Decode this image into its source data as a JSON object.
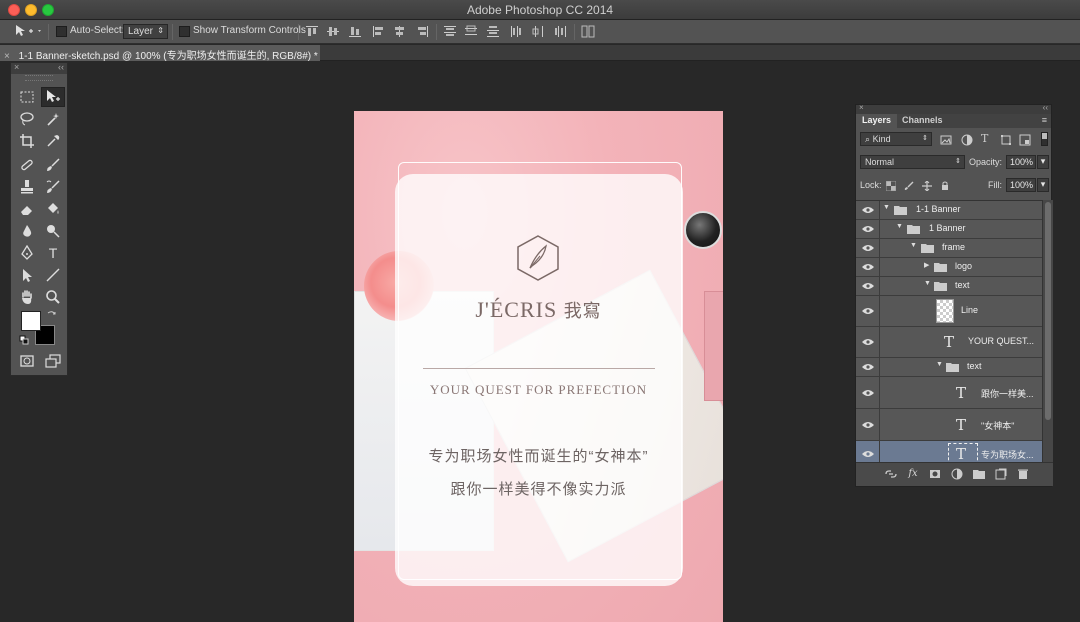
{
  "app": {
    "title": "Adobe Photoshop CC 2014"
  },
  "options_bar": {
    "auto_select_label": "Auto-Select:",
    "auto_select_value": "Layer",
    "show_transform_label": "Show Transform Controls"
  },
  "document": {
    "tab_title": "1-1 Banner-sketch.psd @ 100% (专为职场女性而诞生的, RGB/8#) *"
  },
  "toolbox": {
    "tools": [
      "rectangular-marquee",
      "move",
      "lasso",
      "magic-wand",
      "crop",
      "eyedropper",
      "spot-healing",
      "brush",
      "clone-stamp",
      "history-brush",
      "eraser",
      "paint-bucket",
      "blur",
      "dodge",
      "pen",
      "type",
      "path-selection",
      "line",
      "hand",
      "zoom"
    ],
    "foreground_color": "#ffffff",
    "background_color": "#000000"
  },
  "canvas": {
    "brand_latin": "J'ÉCRIS",
    "brand_cn": "我寫",
    "tagline": "YOUR QUEST FOR PREFECTION",
    "line1": "专为职场女性而诞生的“女神本”",
    "line2": "跟你一样美得不像实力派"
  },
  "layers_panel": {
    "tabs": [
      "Layers",
      "Channels"
    ],
    "filter_kind": "Kind",
    "blend_mode": "Normal",
    "opacity_label": "Opacity:",
    "opacity_value": "100%",
    "lock_label": "Lock:",
    "fill_label": "Fill:",
    "fill_value": "100%",
    "rows": [
      {
        "name": "1-1 Banner",
        "type": "group",
        "indent": 0,
        "expanded": true
      },
      {
        "name": "1 Banner",
        "type": "group",
        "indent": 1,
        "expanded": true
      },
      {
        "name": "frame",
        "type": "group",
        "indent": 2,
        "expanded": true
      },
      {
        "name": "logo",
        "type": "group",
        "indent": 3,
        "expanded": false
      },
      {
        "name": "text",
        "type": "group",
        "indent": 3,
        "expanded": true
      },
      {
        "name": "Line",
        "type": "smart",
        "indent": 4
      },
      {
        "name": "YOUR QUEST...",
        "type": "text",
        "indent": 4
      },
      {
        "name": "text",
        "type": "group",
        "indent": 4,
        "expanded": true
      },
      {
        "name": "跟你一样美...",
        "type": "text",
        "indent": 5
      },
      {
        "name": "\"女神本\"",
        "type": "text",
        "indent": 5
      },
      {
        "name": "专为职场女...",
        "type": "text",
        "indent": 5,
        "selected": true
      }
    ]
  },
  "colors": {
    "selection": "#6b7a92",
    "panel": "#535353",
    "canvas_bg": "#282828"
  }
}
